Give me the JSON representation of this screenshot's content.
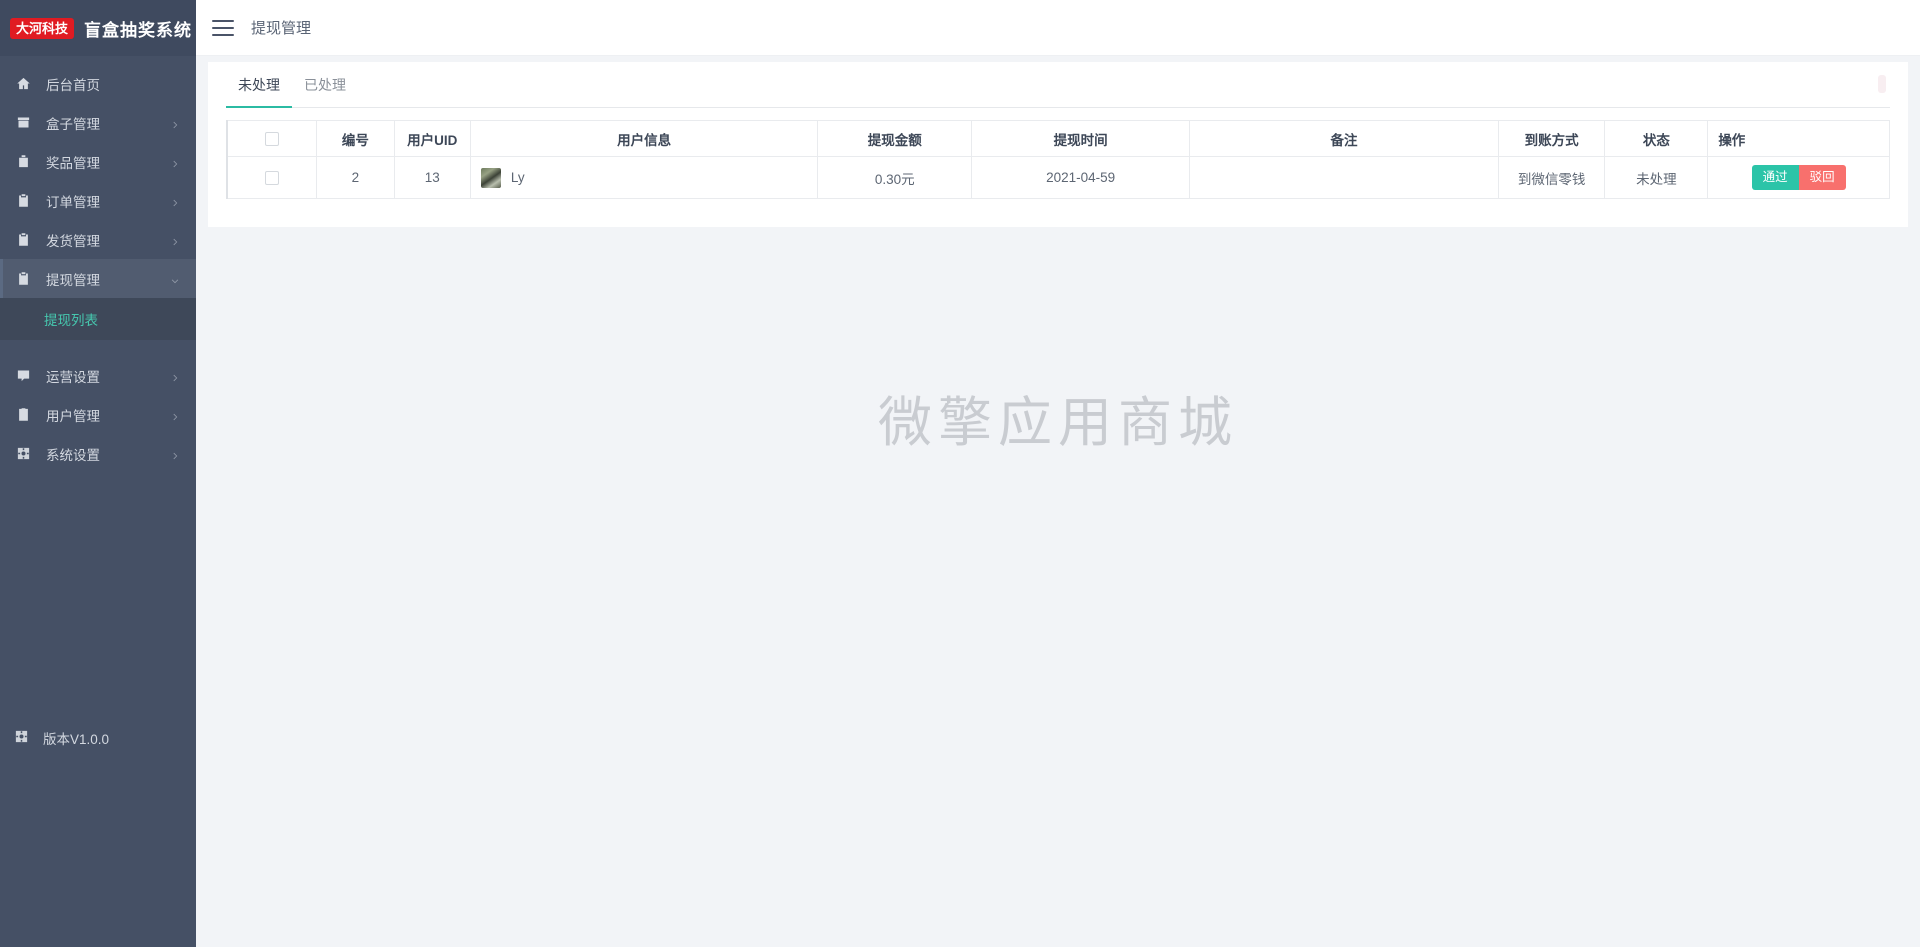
{
  "brand": {
    "badge": "大河科技",
    "title": "盲盒抽奖系统"
  },
  "topbar": {
    "menu_icon": "hamburger-icon",
    "title": "提现管理"
  },
  "sidebar": {
    "items": [
      {
        "label": "后台首页",
        "icon": "home-icon",
        "has_arrow": false,
        "active": false
      },
      {
        "label": "盒子管理",
        "icon": "box-icon",
        "has_arrow": true,
        "active": false
      },
      {
        "label": "奖品管理",
        "icon": "gift-icon",
        "has_arrow": true,
        "active": false
      },
      {
        "label": "订单管理",
        "icon": "clipboard-icon",
        "has_arrow": true,
        "active": false
      },
      {
        "label": "发货管理",
        "icon": "clipboard-icon",
        "has_arrow": true,
        "active": false
      },
      {
        "label": "提现管理",
        "icon": "clipboard-icon",
        "has_arrow": true,
        "active": true
      }
    ],
    "submenu": [
      {
        "label": "提现列表",
        "active": true
      }
    ],
    "items_after": [
      {
        "label": "运营设置",
        "icon": "pencil-icon",
        "has_arrow": true,
        "active": false
      },
      {
        "label": "用户管理",
        "icon": "user-icon",
        "has_arrow": true,
        "active": false
      },
      {
        "label": "系统设置",
        "icon": "gear-icon",
        "has_arrow": true,
        "active": false
      }
    ],
    "version": {
      "label": "版本V1.0.0",
      "icon": "gear-icon"
    }
  },
  "tabs": [
    {
      "label": "未处理",
      "active": true
    },
    {
      "label": "已处理",
      "active": false
    }
  ],
  "table": {
    "headers": [
      "",
      "编号",
      "用户UID",
      "用户信息",
      "提现金额",
      "提现时间",
      "备注",
      "到账方式",
      "状态",
      "操作"
    ],
    "rows": [
      {
        "no": "2",
        "uid": "13",
        "user_name": "Ly",
        "amount": "0.30元",
        "time": "2021-04-59",
        "note": "",
        "pay_method": "到微信零钱",
        "status": "未处理",
        "actions": {
          "pass": "通过",
          "reject": "驳回"
        }
      }
    ]
  },
  "watermark": "微擎应用商城",
  "colors": {
    "sidebar_bg": "#455065",
    "brand_red": "#e01b22",
    "accent_teal": "#2bbba3",
    "btn_pass": "#2bc4a8",
    "btn_reject": "#f8706d",
    "submenu_active_text": "#46c8af"
  }
}
